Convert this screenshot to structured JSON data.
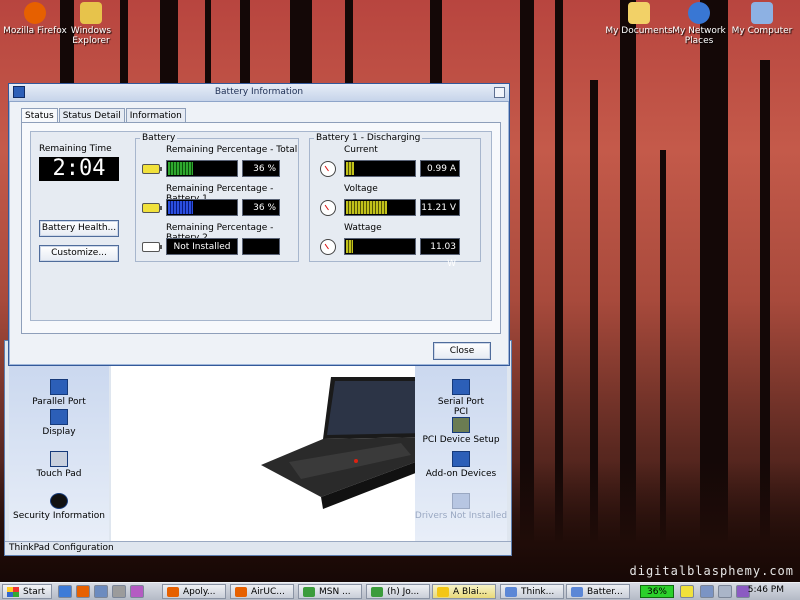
{
  "desktop": {
    "icons_left": [
      {
        "label": "Mozilla Firefox",
        "color": "#e66000"
      },
      {
        "label": "Windows Explorer",
        "color": "#e7c34b"
      }
    ],
    "icons_right": [
      {
        "label": "My Documents",
        "color": "#f2d167"
      },
      {
        "label": "My Network Places",
        "color": "#3977d4"
      },
      {
        "label": "My Computer",
        "color": "#8db1e3"
      }
    ],
    "watermark": "digitalblasphemy.com"
  },
  "thinkpad_window": {
    "status": "ThinkPad Configuration",
    "left_items": [
      "Parallel Port",
      "Display",
      "Touch Pad",
      "Security Information"
    ],
    "right_items": [
      "Serial Port",
      "PCI Device Setup",
      "Add-on Devices",
      "Drivers Not Installed"
    ],
    "pci_label": "PCI"
  },
  "battery_window": {
    "title": "Battery Information",
    "tabs": [
      "Status",
      "Status Detail",
      "Information"
    ],
    "remaining_time_label": "Remaining Time",
    "remaining_time": "2:04",
    "buttons": {
      "health": "Battery Health...",
      "customize": "Customize...",
      "close": "Close"
    },
    "battery_group": {
      "title": "Battery",
      "total_label": "Remaining Percentage - Total",
      "total_value": "36 %",
      "total_fraction": 0.36,
      "b1_label": "Remaining Percentage - Battery 1",
      "b1_value": "36 %",
      "b1_fraction": 0.36,
      "b2_label": "Remaining Percentage - Battery 2",
      "b2_value": "Not Installed"
    },
    "discharge_group": {
      "title": "Battery 1 - Discharging",
      "current_label": "Current",
      "current_value": "0.99 A",
      "current_fraction": 0.12,
      "voltage_label": "Voltage",
      "voltage_value": "11.21 V",
      "voltage_fraction": 0.58,
      "wattage_label": "Wattage",
      "wattage_value": "11.03 W",
      "wattage_fraction": 0.1
    }
  },
  "taskbar": {
    "start_label": "Start",
    "tasks": [
      "Apoly...",
      "AirUC...",
      "MSN ...",
      "(h) Jo...",
      "A Blai...",
      "Think...",
      "Batter..."
    ],
    "active_task": "A Blai...",
    "battery_tray": "36%",
    "clock": "5:46 PM"
  }
}
